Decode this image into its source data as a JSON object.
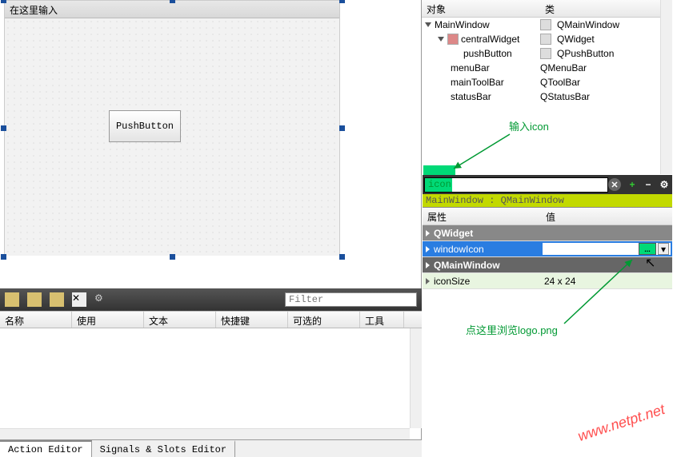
{
  "form": {
    "title": "在这里输入",
    "button_label": "PushButton"
  },
  "tree": {
    "col1": "对象",
    "col2": "类",
    "rows": [
      {
        "name": "MainWindow",
        "cls": "QMainWindow",
        "depth": 0,
        "exp": true
      },
      {
        "name": "centralWidget",
        "cls": "QWidget",
        "depth": 1,
        "exp": true,
        "ico": true
      },
      {
        "name": "pushButton",
        "cls": "QPushButton",
        "depth": 2,
        "ico": true
      },
      {
        "name": "menuBar",
        "cls": "QMenuBar",
        "depth": 1
      },
      {
        "name": "mainToolBar",
        "cls": "QToolBar",
        "depth": 1
      },
      {
        "name": "statusBar",
        "cls": "QStatusBar",
        "depth": 1
      }
    ]
  },
  "filter_value": "icon",
  "breadcrumb": "MainWindow : QMainWindow",
  "props": {
    "col1": "属性",
    "col2": "值",
    "rows": [
      {
        "group": true,
        "name": "QWidget"
      },
      {
        "name": "windowIcon",
        "value": "",
        "selected": true,
        "browse": true
      },
      {
        "group": true,
        "dark": true,
        "name": "QMainWindow"
      },
      {
        "name": "iconSize",
        "value": "24 x 24",
        "pale": true
      }
    ]
  },
  "anno1": "输入icon",
  "anno2": "点这里浏览logo.png",
  "action_cols": {
    "c1": "名称",
    "c2": "使用",
    "c3": "文本",
    "c4": "快捷键",
    "c5": "可选的",
    "c6": "工具"
  },
  "filter_placeholder": "Filter",
  "tabs": {
    "t1": "Action Editor",
    "t2": "Signals & Slots Editor"
  },
  "watermark": "www.netpt.net",
  "browse_label": "..."
}
